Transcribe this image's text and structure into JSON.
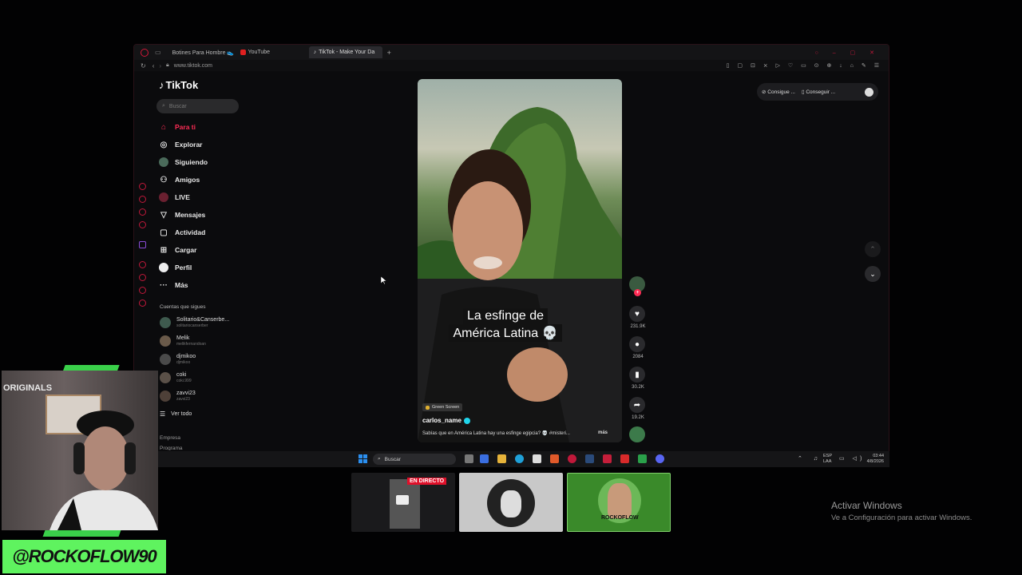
{
  "browser": {
    "tabs": [
      {
        "label": "Botines Para Hombre 👟",
        "icon": "shop-icon",
        "color": "#e0b030"
      },
      {
        "label": "YouTube",
        "icon": "youtube-icon",
        "color": "#e02020"
      },
      {
        "label": "TikTok - Make Your Da",
        "icon": "tiktok-icon",
        "color": "#ffffff"
      }
    ],
    "url": "www.tiktok.com"
  },
  "tiktok": {
    "logo": "TikTok",
    "search_placeholder": "Buscar",
    "nav": [
      {
        "label": "Para ti",
        "icon": "home-icon",
        "active": true
      },
      {
        "label": "Explorar",
        "icon": "compass-icon"
      },
      {
        "label": "Siguiendo",
        "icon": "following-icon"
      },
      {
        "label": "Amigos",
        "icon": "friends-icon"
      },
      {
        "label": "LIVE",
        "icon": "live-icon"
      },
      {
        "label": "Mensajes",
        "icon": "messages-icon"
      },
      {
        "label": "Actividad",
        "icon": "activity-icon"
      },
      {
        "label": "Cargar",
        "icon": "upload-icon"
      },
      {
        "label": "Perfil",
        "icon": "profile-icon"
      },
      {
        "label": "Más",
        "icon": "more-icon"
      }
    ],
    "following_title": "Cuentas que sigues",
    "accounts": [
      {
        "name": "Solitario&Canserbe...",
        "handle": "solitariocanserber"
      },
      {
        "name": "Melik",
        "handle": "melikfernandoan"
      },
      {
        "name": "djmikoo",
        "handle": "djmikoo"
      },
      {
        "name": "coki",
        "handle": "coki.999"
      },
      {
        "name": "zavvi23",
        "handle": "zavvi23"
      }
    ],
    "see_all": "Ver todo",
    "footer": [
      "Empresa",
      "Programa"
    ],
    "top_right": {
      "btn1": "Consigue ...",
      "btn2": "Conseguir ..."
    },
    "video": {
      "caption_line1": "La esfinge de",
      "caption_line2": "América Latina 💀",
      "tag": "Green Screen",
      "author": "carlos_name",
      "description": "Sabías que en América Latina hay una esfinge egipcia? 💀 #misteri...",
      "more": "más"
    },
    "counts": {
      "likes": "231.9K",
      "comments": "2084",
      "saves": "30.2K",
      "shares": "19.2K"
    }
  },
  "taskbar": {
    "search_placeholder": "Buscar",
    "lang1": "ESP",
    "lang2": "LAA",
    "time": "03:44",
    "date": "4/8/2026"
  },
  "overlay": {
    "live_badge": "EN DIRECTO",
    "activate_title": "Activar Windows",
    "activate_sub": "Ve a Configuración para activar Windows.",
    "webcam_label": "ORIGINALS",
    "handle_logo": "@ROCKOFLOW90",
    "thumb_label": "ROCKOFLOW"
  },
  "colors": {
    "accent": "#fe2c55",
    "verified": "#20d5ec",
    "logo_green": "#5ff35f"
  }
}
